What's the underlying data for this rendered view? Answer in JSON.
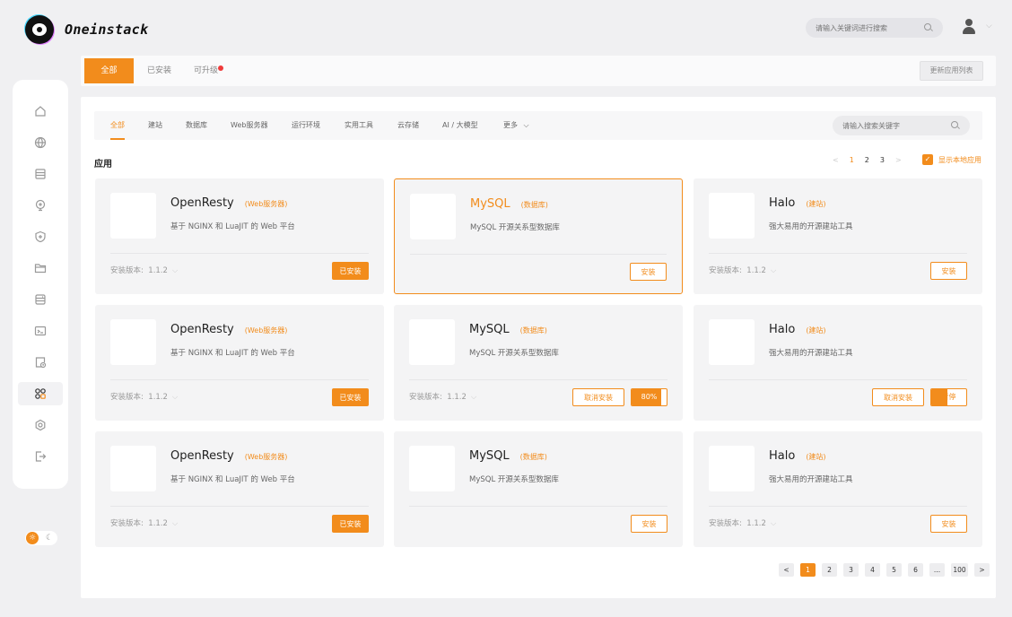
{
  "header": {
    "logo_text": "Oneinstack",
    "search_placeholder": "请输入关键词进行搜索"
  },
  "top_tabs": [
    {
      "label": "全部",
      "active": true
    },
    {
      "label": "已安装",
      "active": false
    },
    {
      "label": "可升级",
      "active": false,
      "badge": true
    }
  ],
  "update_button": "更新应用列表",
  "sidebar": {
    "items": [
      {
        "icon": "home-icon"
      },
      {
        "icon": "globe-icon"
      },
      {
        "icon": "database-icon"
      },
      {
        "icon": "monitor-icon"
      },
      {
        "icon": "shield-icon"
      },
      {
        "icon": "folder-icon"
      },
      {
        "icon": "server-icon"
      },
      {
        "icon": "terminal-icon"
      },
      {
        "icon": "schedule-icon"
      },
      {
        "icon": "apps-icon",
        "active": true
      },
      {
        "icon": "settings-icon"
      },
      {
        "icon": "logout-icon"
      }
    ]
  },
  "categories": {
    "items": [
      "全部",
      "建站",
      "数据库",
      "Web服务器",
      "运行环境",
      "实用工具",
      "云存储",
      "AI / 大模型",
      "更多"
    ],
    "active_index": 0,
    "search_placeholder": "请输入搜索关键字"
  },
  "section": {
    "title": "应用",
    "mini_pager": {
      "prev": "<",
      "pages": [
        "1",
        "2",
        "3"
      ],
      "next": ">",
      "current": "1"
    },
    "show_local_label": "显示本地应用"
  },
  "labels": {
    "version": "安装版本:",
    "installed": "已安装",
    "install": "安装",
    "cancel_install": "取消安装",
    "pause": "暂停"
  },
  "cards": [
    {
      "name": "OpenResty",
      "tag": "(Web服务器)",
      "desc": "基于 NGINX 和 LuaJIT 的 Web 平台",
      "version": "1.1.2",
      "state": "installed"
    },
    {
      "name": "MySQL",
      "tag": "(数据库)",
      "desc": "MySQL 开源关系型数据库",
      "state": "install",
      "highlight": true
    },
    {
      "name": "Halo",
      "tag": "(建站)",
      "desc": "强大易用的开源建站工具",
      "version": "1.1.2",
      "state": "install"
    },
    {
      "name": "OpenResty",
      "tag": "(Web服务器)",
      "desc": "基于 NGINX 和 LuaJIT 的 Web 平台",
      "version": "1.1.2",
      "state": "installed"
    },
    {
      "name": "MySQL",
      "tag": "(数据库)",
      "desc": "MySQL 开源关系型数据库",
      "version": "1.1.2",
      "state": "progress",
      "progress": 0.8,
      "progress_label": "80%"
    },
    {
      "name": "Halo",
      "tag": "(建站)",
      "desc": "强大易用的开源建站工具",
      "state": "paused",
      "progress": 0.45
    },
    {
      "name": "OpenResty",
      "tag": "(Web服务器)",
      "desc": "基于 NGINX 和 LuaJIT 的 Web 平台",
      "version": "1.1.2",
      "state": "installed"
    },
    {
      "name": "MySQL",
      "tag": "(数据库)",
      "desc": "MySQL 开源关系型数据库",
      "state": "install"
    },
    {
      "name": "Halo",
      "tag": "(建站)",
      "desc": "强大易用的开源建站工具",
      "version": "1.1.2",
      "state": "install"
    }
  ],
  "pager": {
    "prev": "<",
    "pages": [
      "1",
      "2",
      "3",
      "4",
      "5",
      "6",
      "...",
      "100"
    ],
    "next": ">",
    "current": "1"
  },
  "colors": {
    "accent": "#f28c1c",
    "badge": "#ef3a3a"
  }
}
